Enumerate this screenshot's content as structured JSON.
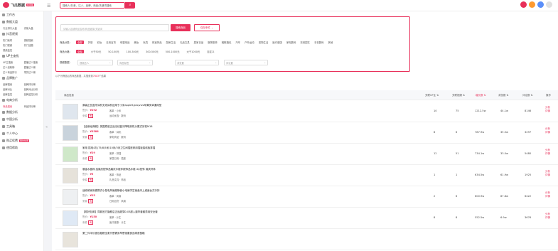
{
  "brand": {
    "name": "飞瓜数据",
    "badge": "抖音版"
  },
  "top_search": {
    "placeholder": "搜索人/抖音、达人、品牌、商品/关键词搜索",
    "button": "⌕"
  },
  "sidebar": [
    {
      "title": "工作台"
    },
    {
      "title": "数据大盘",
      "rows": [
        [
          "行业排行大盘",
          "流量大盘"
        ]
      ]
    },
    {
      "title": "抖音视频",
      "rows": [
        [
          "热门素材",
          "视频搜索"
        ],
        [
          "热门视频",
          "热门话题"
        ],
        [
          "视频监控",
          ""
        ]
      ]
    },
    {
      "title": "UP主查找",
      "rows": [
        [
          "UP主搜索",
          "直播达人搜索"
        ],
        [
          "达人涨粉榜",
          "直播达人榜"
        ],
        [
          "达人商品排行",
          "带货达人榜"
        ]
      ]
    },
    {
      "title": "品牌推广",
      "rows": [
        [
          "品牌搜索",
          "品牌排行榜"
        ],
        [
          "品牌对比",
          "品牌对比分析"
        ],
        [
          "品牌监控",
          "品牌监控分析"
        ]
      ]
    },
    {
      "title": "电商分析",
      "rows": [
        [
          "商品搜索",
          "商品排行榜"
        ]
      ],
      "active_row": 0
    },
    {
      "title": "数据分析"
    },
    {
      "title": "中国分析"
    },
    {
      "title": "工具箱"
    },
    {
      "title": "个人中心"
    },
    {
      "title": "购买续费",
      "badge": "限时优惠"
    },
    {
      "title": "使用帮助"
    }
  ],
  "filter": {
    "keyword_placeholder": "请输入店铺商品名称/商品链接/关键词",
    "search_button": "搜索商品",
    "condition_button": "保存条件 ⌄",
    "category_label": "商品分类：",
    "categories": [
      "全部",
      "护肤",
      "彩妆",
      "日用百货",
      "母婴用品",
      "美妆",
      "玩具",
      "珠宝饰品",
      "厨房生活",
      "礼品文具",
      "居家日品",
      "服饰配饰",
      "鞋靴箱包",
      "汽车",
      "户外运动",
      "宠物生活",
      "医疗健康",
      "家电数码",
      "农资园艺"
    ],
    "categories_extra": [
      "手机数码",
      "其他"
    ],
    "price_label": "商品价格：",
    "prices": [
      "全部",
      "小于50元",
      "50-100元",
      "100-300元",
      "300-500元",
      "500-1000元",
      "大于1000元",
      "自定义"
    ],
    "other_label": "视频数据：",
    "selects": [
      "视频达人",
      "商品标签",
      "浏览数",
      "评论数"
    ]
  },
  "tip": {
    "prefix": "以下为筛选后的商品数据，共搜索到",
    "count": "7803",
    "suffix": "个结果"
  },
  "table": {
    "headers": [
      "商品信息",
      "关联UP主 ⇅",
      "关联视频 ⇅",
      "增长数 ⇅",
      "浏览数 ⇅",
      "评论数 ⇅",
      "操作"
    ],
    "rows": [
      {
        "title": "原装正品蓝牙耳机无线耳机适用于小米apple5/pro/vivo苹果安卓通用型",
        "price": "¥292",
        "shop": "客单 · 小米",
        "source": "来源",
        "cat": "运动优选 · 数码",
        "up": "10",
        "video": "75",
        "growth": "1212.5w",
        "views": "44.1w",
        "comments": "8146"
      },
      {
        "title": "【全新经典款】英国原装正品无线蓝牙降噪耳机头戴式耳机M18",
        "price": "¥3588",
        "shop": "客单 · 耳机",
        "source": "来源",
        "cat": "家电商品 · 数码",
        "up": "8",
        "video": "6",
        "growth": "787.9w",
        "views": "35.5w",
        "comments": "3297"
      },
      {
        "title": "家用 插电4孔(75/8)5米/10米/3米卫生间插座家用插板接线板排插",
        "price": "¥29",
        "shop": "客单 · 排插",
        "source": "来源",
        "cat": "家居日用 · 插座",
        "up": "12",
        "video": "51",
        "growth": "734.1w",
        "views": "33.0w",
        "comments": "5480"
      },
      {
        "title": "鎏金水晶珠 结婚庆配饰品婚庆手链伴娘饰品手链 diy配件 婚庆饰件",
        "price": "¥5",
        "shop": "客单 · 饰品",
        "source": "来源",
        "cat": "礼品文具 · 饰品",
        "up": "1",
        "video": "1",
        "growth": "634.5w",
        "views": "61.9w",
        "comments": "1925"
      },
      {
        "title": "迷你款家用便携式小型电风扇超静音小电扇学生宿舍床上桌面台式手持",
        "price": "¥25",
        "shop": "客单 · 风扇",
        "source": "来源",
        "cat": "日用百货 · 风扇",
        "up": "2",
        "video": "6",
        "growth": "600.9w",
        "views": "87.8w",
        "comments": "6422"
      },
      {
        "title": "【刚好包邮】同款官方旗舰店正品超薄0.03超入避孕套套男用安全套",
        "price": "¥150",
        "shop": "客单 · 计生",
        "source": "来源",
        "cat": "医疗健康 · 计生",
        "up": "8",
        "video": "8",
        "growth": "552.5w",
        "views": "6.9w",
        "comments": "3676"
      },
      {
        "title": "第二件半价面包粗粮全麦代餐健身早餐饱腹食品零食整箱",
        "price": "",
        "shop": "",
        "source": "",
        "cat": "",
        "up": "",
        "video": "",
        "growth": "",
        "views": "",
        "comments": ""
      }
    ],
    "action": "分析",
    "action2": "详情"
  }
}
